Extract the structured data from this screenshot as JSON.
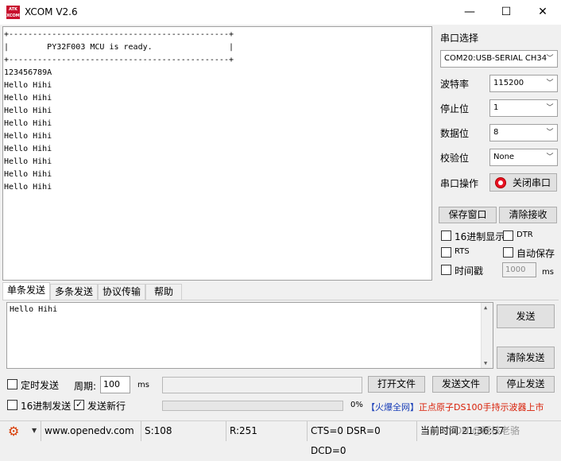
{
  "window": {
    "title": "XCOM V2.6",
    "logo_text": "ATK XCOM",
    "minimize": "—",
    "maximize": "☐",
    "close": "✕"
  },
  "receive": {
    "lines": [
      "+----------------------------------------------+",
      "|        PY32F003 MCU is ready.                |",
      "+----------------------------------------------+",
      "123456789A",
      "Hello Hihi",
      "Hello Hihi",
      "Hello Hihi",
      "Hello Hihi",
      "Hello Hihi",
      "Hello Hihi",
      "Hello Hihi",
      "Hello Hihi",
      "Hello Hihi"
    ]
  },
  "panel": {
    "port_select_label": "串口选择",
    "port_value": "COM20:USB-SERIAL CH34",
    "baud_label": "波特率",
    "baud_value": "115200",
    "stop_label": "停止位",
    "stop_value": "1",
    "data_label": "数据位",
    "data_value": "8",
    "parity_label": "校验位",
    "parity_value": "None",
    "port_op_label": "串口操作",
    "close_port_button": "关闭串口",
    "save_window_button": "保存窗口",
    "clear_recv_button": "清除接收",
    "hex_display_label": "16进制显示",
    "dtr_label": "DTR",
    "rts_label": "RTS",
    "auto_save_label": "自动保存",
    "timestamp_label": "时间戳",
    "timestamp_value": "1000",
    "timestamp_unit": "ms"
  },
  "tabs": [
    "单条发送",
    "多条发送",
    "协议传输",
    "帮助"
  ],
  "send": {
    "text": "Hello Hihi",
    "send_button": "发送",
    "clear_send_button": "清除发送",
    "timed_send_label": "定时发送",
    "period_label": "周期:",
    "period_value": "100",
    "period_unit": "ms",
    "open_file_button": "打开文件",
    "send_file_button": "发送文件",
    "stop_send_button": "停止发送",
    "hex_send_label": "16进制发送",
    "newline_label": "发送新行",
    "progress_text": "0%",
    "progress": 0,
    "promo_prefix": "【火爆全网】",
    "promo_text": "正点原子DS100手持示波器上市"
  },
  "status": {
    "website": "www.openedv.com",
    "sent": "S:108",
    "received": "R:251",
    "lines": "CTS=0 DSR=0 DCD=0",
    "time": "当前时间 21:36:57",
    "watermark": "CSDN @硬核老骆"
  },
  "colors": {
    "accent": "#0078d7",
    "record_red": "#e81123",
    "promo_blue": "#1a3fb8",
    "promo_red": "#d81e06"
  }
}
